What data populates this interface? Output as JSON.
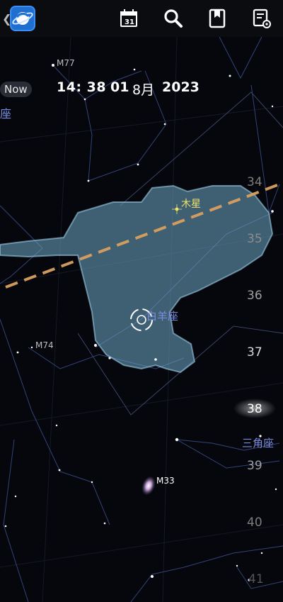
{
  "toolbar": {
    "calendar_day": "31",
    "icons": [
      "back-chevron-icon",
      "app-logo-icon",
      "calendar-icon",
      "search-icon",
      "bookmark-icon",
      "settings-icon"
    ]
  },
  "status": {
    "now_label": "Now",
    "time": "14: 38",
    "day": "01",
    "month": "8月",
    "year": "2023"
  },
  "sky": {
    "left_edge_label": "座",
    "objects": {
      "m77": "M77",
      "m74": "M74",
      "m33": "M33",
      "jupiter": "木星",
      "aries": "白羊座",
      "triangulum": "三角座"
    },
    "declination_ticks": [
      "34",
      "35",
      "36",
      "37",
      "38",
      "39",
      "40",
      "41"
    ]
  },
  "colors": {
    "sky_background": "#05070d",
    "toolbar": "#0b0c10",
    "constellation_fill": "#6fa8c9",
    "ecliptic": "#d9a060",
    "label_blue": "#7a8ce0",
    "jupiter_label": "#f2e36a"
  }
}
